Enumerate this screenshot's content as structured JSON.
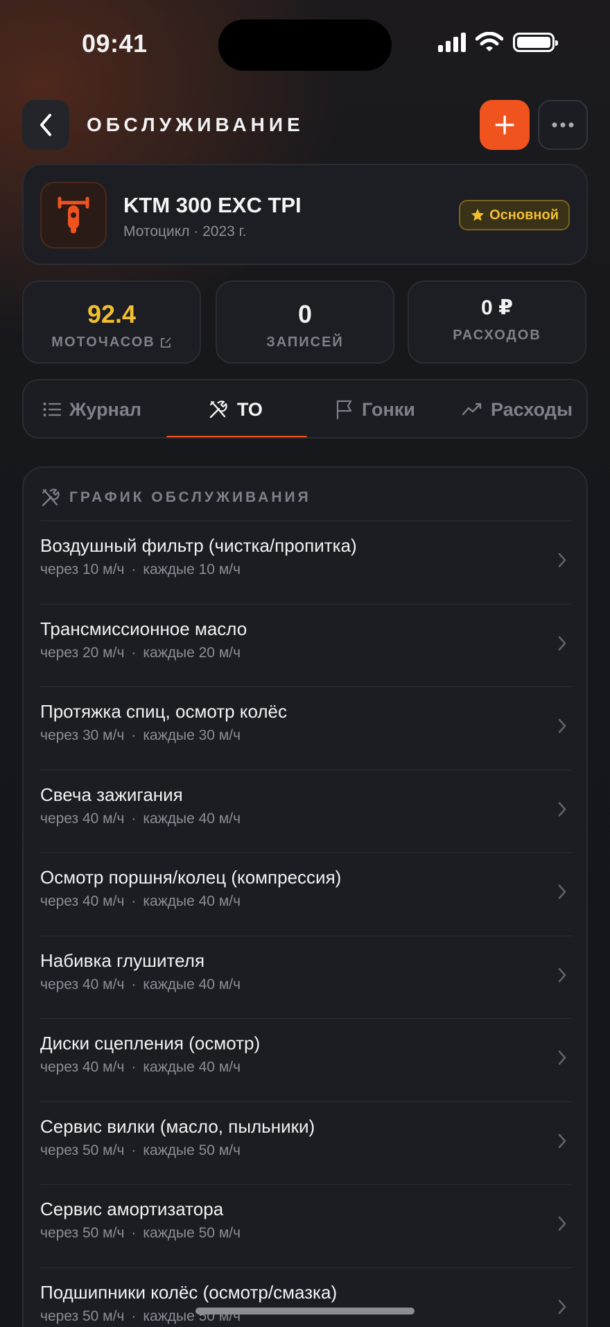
{
  "status": {
    "time": "09:41"
  },
  "header": {
    "title": "ОБСЛУЖИВАНИЕ"
  },
  "vehicle": {
    "name": "KTM 300 EXC TPI",
    "subtitle": "Мотоцикл · 2023 г.",
    "badge": "Основной"
  },
  "stats": [
    {
      "value": "92.4",
      "label": "МОТОЧАСОВ",
      "color": "#f2bf2e"
    },
    {
      "value": "0",
      "label": "ЗАПИСЕЙ",
      "color": "#f5f5f7"
    },
    {
      "value": "0 ₽",
      "label": "РАСХОДОВ",
      "color": "#f5f5f7"
    }
  ],
  "tabs": [
    {
      "label": "Журнал",
      "icon": "list-icon"
    },
    {
      "label": "ТО",
      "icon": "tools-icon",
      "active": true
    },
    {
      "label": "Гонки",
      "icon": "flag-icon"
    },
    {
      "label": "Расходы",
      "icon": "trend-icon"
    }
  ],
  "schedule": {
    "title": "ГРАФИК ОБСЛУЖИВАНИЯ",
    "items": [
      {
        "title": "Воздушный фильтр (чистка/пропитка)",
        "due": "через 10 м/ч",
        "interval": "каждые 10 м/ч"
      },
      {
        "title": "Трансмиссионное масло",
        "due": "через 20 м/ч",
        "interval": "каждые 20 м/ч"
      },
      {
        "title": "Протяжка спиц, осмотр колёс",
        "due": "через 30 м/ч",
        "interval": "каждые 30 м/ч"
      },
      {
        "title": "Свеча зажигания",
        "due": "через 40 м/ч",
        "interval": "каждые 40 м/ч"
      },
      {
        "title": "Осмотр поршня/колец (компрессия)",
        "due": "через 40 м/ч",
        "interval": "каждые 40 м/ч"
      },
      {
        "title": "Набивка глушителя",
        "due": "через 40 м/ч",
        "interval": "каждые 40 м/ч"
      },
      {
        "title": "Диски сцепления (осмотр)",
        "due": "через 40 м/ч",
        "interval": "каждые 40 м/ч"
      },
      {
        "title": "Сервис вилки (масло, пыльники)",
        "due": "через 50 м/ч",
        "interval": "каждые 50 м/ч"
      },
      {
        "title": "Сервис амортизатора",
        "due": "через 50 м/ч",
        "interval": "каждые 50 м/ч"
      },
      {
        "title": "Подшипники колёс (осмотр/смазка)",
        "due": "через 50 м/ч",
        "interval": "каждые 50 м/ч"
      }
    ]
  },
  "colors": {
    "accent": "#f0531e",
    "highlight": "#f2bf2e"
  }
}
